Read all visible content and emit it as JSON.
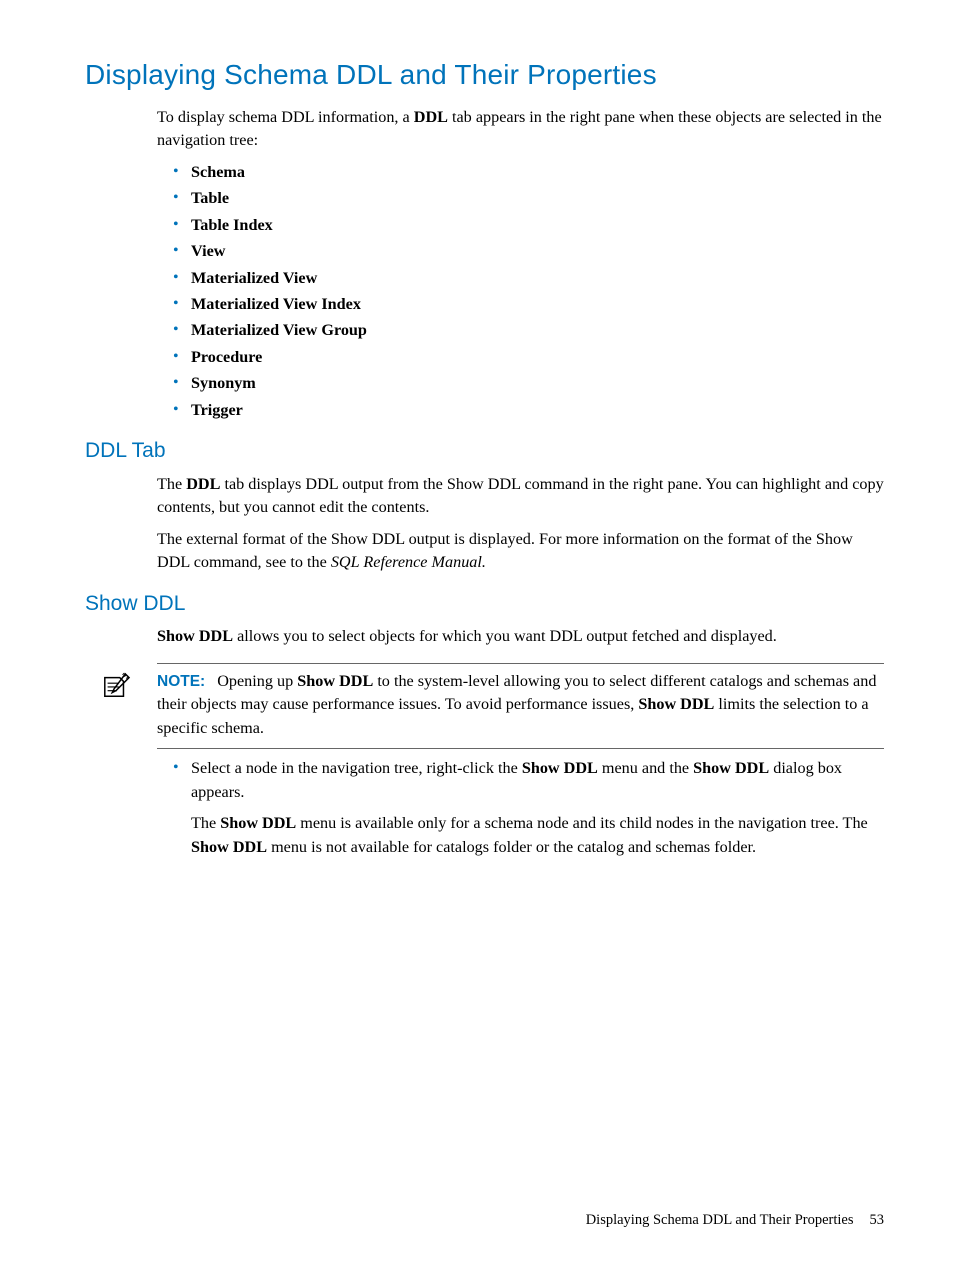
{
  "h1": "Displaying Schema DDL and Their Properties",
  "intro_pre": "To display schema DDL information, a ",
  "intro_bold": "DDL",
  "intro_post": " tab appears in the right pane when these objects are selected in the navigation tree:",
  "bullets_main": [
    "Schema",
    "Table",
    "Table Index",
    "View",
    "Materialized View",
    "Materialized View Index",
    "Materialized View Group",
    "Procedure",
    "Synonym",
    "Trigger"
  ],
  "ddl_tab": {
    "title": "DDL Tab",
    "p1_pre": "The ",
    "p1_bold": "DDL",
    "p1_post": " tab displays DDL output from the Show DDL command in the right pane. You can highlight and copy contents, but you cannot edit the contents.",
    "p2_pre": "The external format of the Show DDL output is displayed. For more information on the format of the Show DDL command, see to the ",
    "p2_ital": "SQL Reference Manual.",
    "p2_post": ""
  },
  "show_ddl": {
    "title": "Show DDL",
    "p1_bold": "Show DDL",
    "p1_post": " allows you to select objects for which you want DDL output fetched and displayed.",
    "note_label": "NOTE:",
    "note_seg1": "Opening up ",
    "note_b1": "Show DDL",
    "note_seg2": " to the system-level allowing you to select different catalogs and schemas and their objects may cause performance issues. To avoid performance issues, ",
    "note_b2": "Show DDL",
    "note_seg3": " limits the selection to a specific schema.",
    "bul1_seg1": "Select a node in the navigation tree, right-click the ",
    "bul1_b1": "Show DDL",
    "bul1_seg2": " menu and the ",
    "bul1_b2": "Show DDL",
    "bul1_seg3": " dialog box appears.",
    "bul1_p2_seg1": "The ",
    "bul1_p2_b1": "Show DDL",
    "bul1_p2_seg2": " menu is available only for a schema node and its child nodes in the navigation tree. The ",
    "bul1_p2_b2": "Show DDL",
    "bul1_p2_seg3": " menu is not available for catalogs folder or the catalog and schemas folder."
  },
  "footer_text": "Displaying Schema DDL and Their Properties",
  "footer_page": "53"
}
